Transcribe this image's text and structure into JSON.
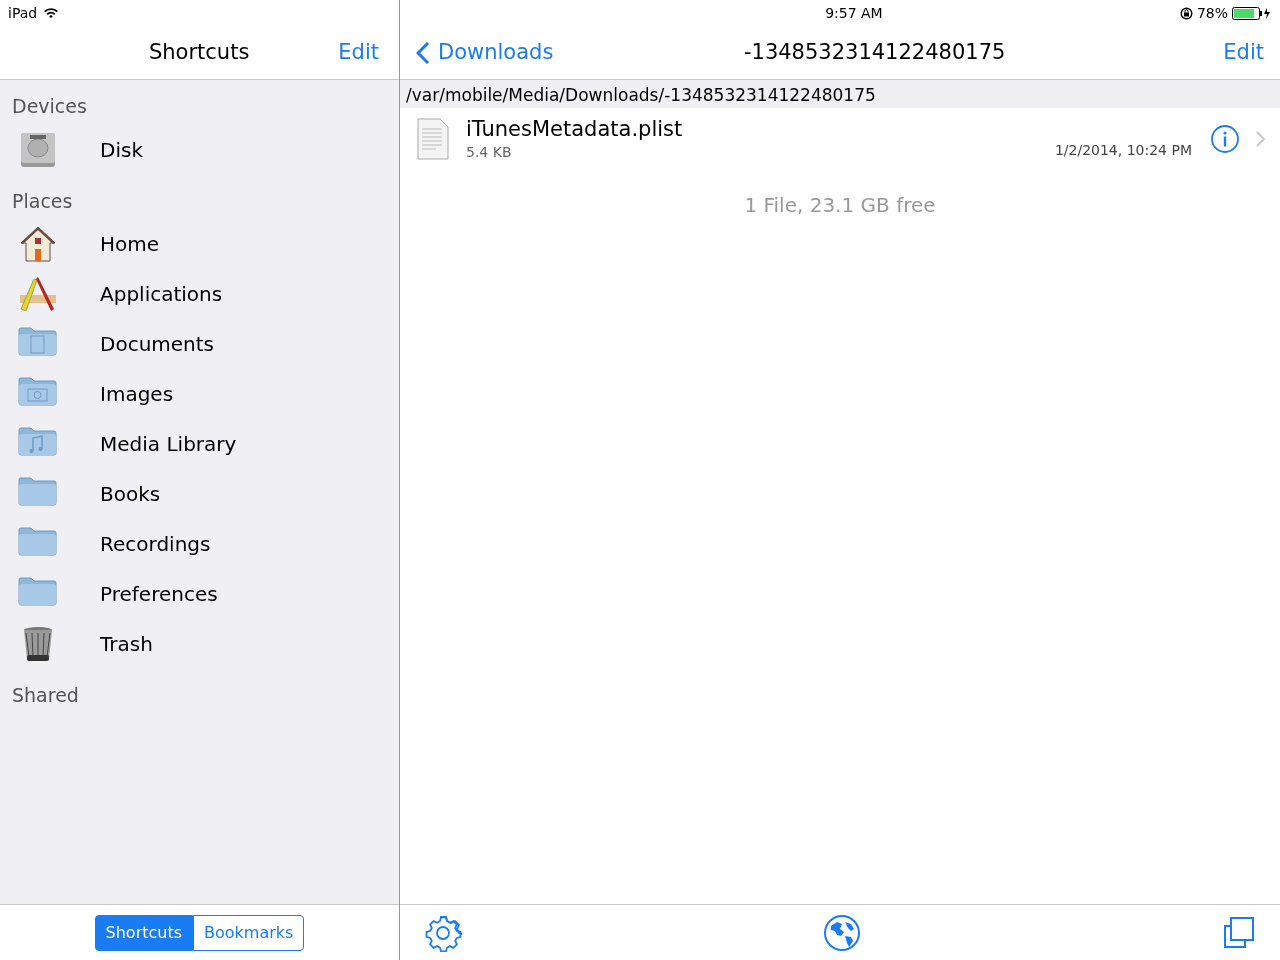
{
  "status_bar": {
    "device": "iPad",
    "time": "9:57 AM",
    "battery": "78%"
  },
  "sidebar": {
    "title": "Shortcuts",
    "edit": "Edit",
    "sections": [
      {
        "heading": "Devices",
        "items": [
          {
            "label": "Disk",
            "kind": "disk"
          }
        ]
      },
      {
        "heading": "Places",
        "items": [
          {
            "label": "Home",
            "kind": "home"
          },
          {
            "label": "Applications",
            "kind": "applications"
          },
          {
            "label": "Documents",
            "kind": "folder-document"
          },
          {
            "label": "Images",
            "kind": "folder-camera"
          },
          {
            "label": "Media Library",
            "kind": "folder-music"
          },
          {
            "label": "Books",
            "kind": "folder"
          },
          {
            "label": "Recordings",
            "kind": "folder"
          },
          {
            "label": "Preferences",
            "kind": "folder"
          },
          {
            "label": "Trash",
            "kind": "trash"
          }
        ]
      },
      {
        "heading": "Shared"
      }
    ],
    "segments": [
      {
        "label": "Shortcuts",
        "selected": true
      },
      {
        "label": "Bookmarks",
        "selected": false
      }
    ]
  },
  "main": {
    "back": "Downloads",
    "title": "-1348532314122480175",
    "edit": "Edit",
    "path": "/var/mobile/Media/Downloads/-1348532314122480175",
    "files": [
      {
        "name": "iTunesMetadata.plist",
        "size": "5.4 KB",
        "date": "1/2/2014, 10:24 PM"
      }
    ],
    "summary": "1 File, 23.1 GB free"
  }
}
